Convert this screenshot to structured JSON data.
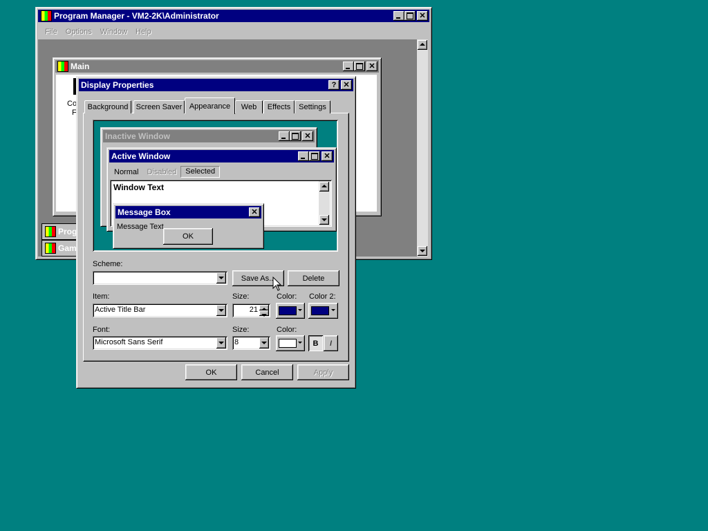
{
  "colors": {
    "desktop": "#008080",
    "active_title": "#000080",
    "inactive_title": "#808080",
    "face": "#c0c0c0",
    "color_navy": "#000080",
    "color_white": "#ffffff"
  },
  "program_manager": {
    "title": "Program Manager - VM2-2K\\Administrator",
    "menu": [
      "File",
      "Options",
      "Window",
      "Help"
    ],
    "main_window_title": "Main",
    "main_partial_text": [
      "Co",
      "F"
    ],
    "minimized_groups": [
      "Prog",
      "Gam"
    ]
  },
  "display_properties": {
    "title": "Display Properties",
    "help_button": "?",
    "close_button": "✕",
    "tabs": [
      "Background",
      "Screen Saver",
      "Appearance",
      "Web",
      "Effects",
      "Settings"
    ],
    "active_tab": "Appearance",
    "preview": {
      "inactive_title": "Inactive Window",
      "active_title": "Active Window",
      "menu_items": [
        "Normal",
        "Disabled",
        "Selected"
      ],
      "window_text": "Window Text",
      "message_box_title": "Message Box",
      "message_text": "Message Text",
      "ok": "OK"
    },
    "scheme_label": "Scheme:",
    "scheme_value": "",
    "save_as_button": "Save As...",
    "delete_button": "Delete",
    "item_label": "Item:",
    "item_value": "Active Title Bar",
    "item_size_label": "Size:",
    "item_size_value": "21",
    "item_color_label": "Color:",
    "item_color2_label": "Color 2:",
    "font_label": "Font:",
    "font_value": "Microsoft Sans Serif",
    "font_size_label": "Size:",
    "font_size_value": "8",
    "font_color_label": "Color:",
    "bold_button": "B",
    "italic_button": "I",
    "ok_button": "OK",
    "cancel_button": "Cancel",
    "apply_button": "Apply"
  }
}
